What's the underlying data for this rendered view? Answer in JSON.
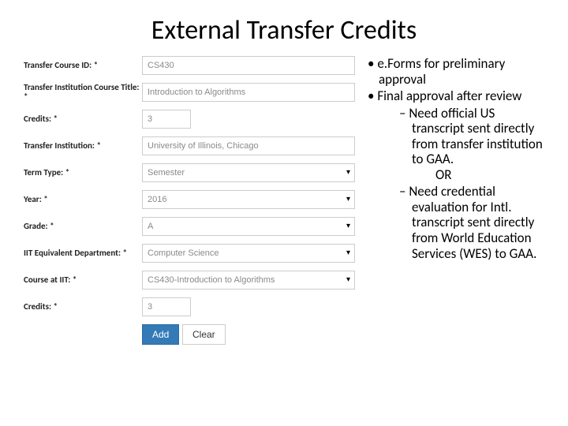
{
  "title": "External Transfer Credits",
  "form": {
    "rows": [
      {
        "label": "Transfer Course ID:",
        "req": true,
        "type": "text",
        "value": "CS430",
        "name": "transfer-course-id"
      },
      {
        "label": "Transfer Institution Course Title:",
        "req": true,
        "type": "text",
        "value": "Introduction to Algorithms",
        "name": "transfer-course-title"
      },
      {
        "label": "Credits:",
        "req": true,
        "type": "number",
        "value": "3",
        "name": "transfer-credits"
      },
      {
        "label": "Transfer Institution:",
        "req": true,
        "type": "text",
        "value": "University of Illinois, Chicago",
        "name": "transfer-institution"
      },
      {
        "label": "Term Type:",
        "req": true,
        "type": "select",
        "value": "Semester",
        "name": "term-type"
      },
      {
        "label": "Year:",
        "req": true,
        "type": "select",
        "value": "2016",
        "name": "year"
      },
      {
        "label": "Grade:",
        "req": true,
        "type": "select",
        "value": "A",
        "name": "grade"
      },
      {
        "label": "IIT Equivalent Department:",
        "req": true,
        "type": "select",
        "value": "Computer Science",
        "name": "iit-department"
      },
      {
        "label": "Course at IIT:",
        "req": true,
        "type": "select",
        "value": "CS430-Introduction to Algorithms",
        "name": "iit-course"
      },
      {
        "label": "Credits:",
        "req": true,
        "type": "number",
        "value": "3",
        "name": "iit-credits"
      }
    ],
    "buttons": {
      "add": "Add",
      "clear": "Clear"
    }
  },
  "bullets": {
    "b1": "e.Forms for preliminary approval",
    "b2": "Final approval after review",
    "sub1": "Need official US transcript sent directly from transfer institution to GAA.",
    "or": "OR",
    "sub2": "Need credential evaluation for Intl. transcript sent directly from World Education Services (WES) to GAA."
  }
}
